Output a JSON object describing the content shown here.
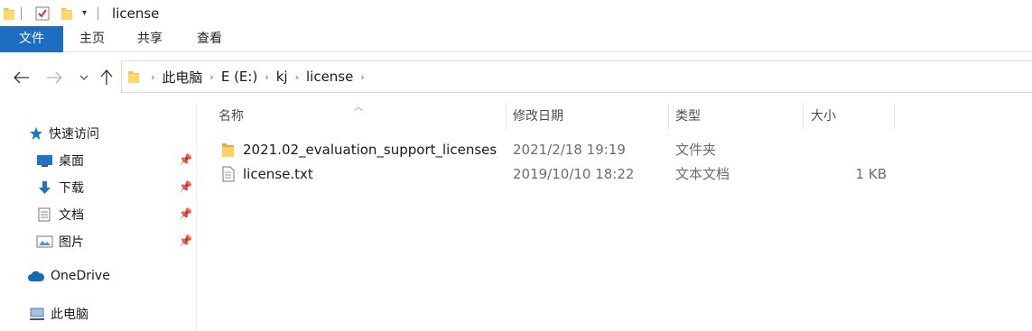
{
  "window": {
    "title": "license"
  },
  "ribbon": {
    "tabs": [
      {
        "label": "文件",
        "active": true
      },
      {
        "label": "主页"
      },
      {
        "label": "共享"
      },
      {
        "label": "查看"
      }
    ]
  },
  "address": {
    "crumbs": [
      "此电脑",
      "E (E:)",
      "kj",
      "license"
    ]
  },
  "sidebar": {
    "quick_access": "快速访问",
    "items": [
      {
        "label": "桌面",
        "icon": "desktop-icon",
        "pinned": true
      },
      {
        "label": "下载",
        "icon": "download-icon",
        "pinned": true
      },
      {
        "label": "文档",
        "icon": "document-icon",
        "pinned": true
      },
      {
        "label": "图片",
        "icon": "pictures-icon",
        "pinned": true
      }
    ],
    "onedrive": "OneDrive",
    "this_pc": "此电脑"
  },
  "columns": {
    "name": "名称",
    "date": "修改日期",
    "type": "类型",
    "size": "大小"
  },
  "files": [
    {
      "name": "2021.02_evaluation_support_licenses",
      "date": "2021/2/18 19:19",
      "type": "文件夹",
      "size": "",
      "icon": "folder-icon"
    },
    {
      "name": "license.txt",
      "date": "2019/10/10 18:22",
      "type": "文本文档",
      "size": "1 KB",
      "icon": "text-file-icon"
    }
  ],
  "colors": {
    "file_tab": "#1b6ec2",
    "folder": "#f4c64e",
    "quick_access_star": "#1b78d6",
    "onedrive": "#0f6cbd"
  }
}
